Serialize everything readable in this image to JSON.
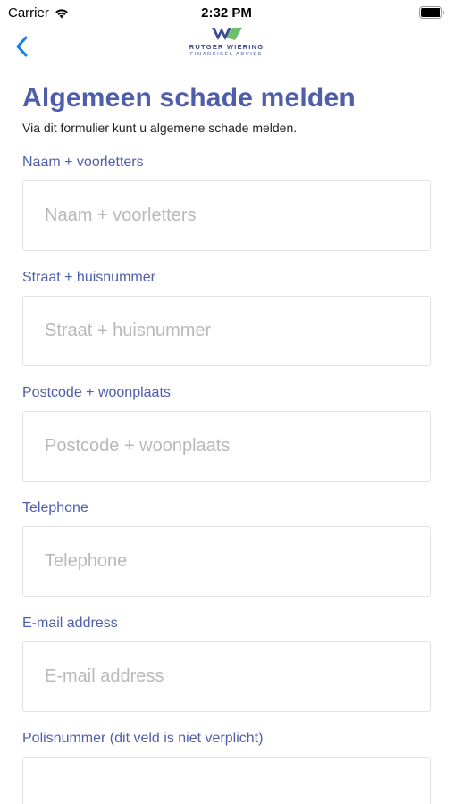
{
  "status_bar": {
    "carrier": "Carrier",
    "time": "2:32 PM"
  },
  "nav": {
    "back_icon": "chevron-left-icon",
    "logo_name": "RUTGER WIERING",
    "logo_sub": "FINANCIEEL ADVIES"
  },
  "form": {
    "title": "Algemeen schade melden",
    "subtitle": "Via dit formulier kunt u algemene schade melden.",
    "fields": [
      {
        "label": "Naam + voorletters",
        "placeholder": "Naam + voorletters",
        "value": ""
      },
      {
        "label": "Straat + huisnummer",
        "placeholder": "Straat + huisnummer",
        "value": ""
      },
      {
        "label": "Postcode + woonplaats",
        "placeholder": "Postcode + woonplaats",
        "value": ""
      },
      {
        "label": "Telephone",
        "placeholder": "Telephone",
        "value": ""
      },
      {
        "label": "E-mail address",
        "placeholder": "E-mail address",
        "value": ""
      },
      {
        "label": "Polisnummer (dit veld is niet verplicht)",
        "placeholder": "",
        "value": ""
      }
    ]
  },
  "colors": {
    "accent": "#4f5ea8",
    "back_blue": "#1a7cf5",
    "logo_green": "#5cb85c",
    "logo_blue": "#3d4a8f"
  }
}
